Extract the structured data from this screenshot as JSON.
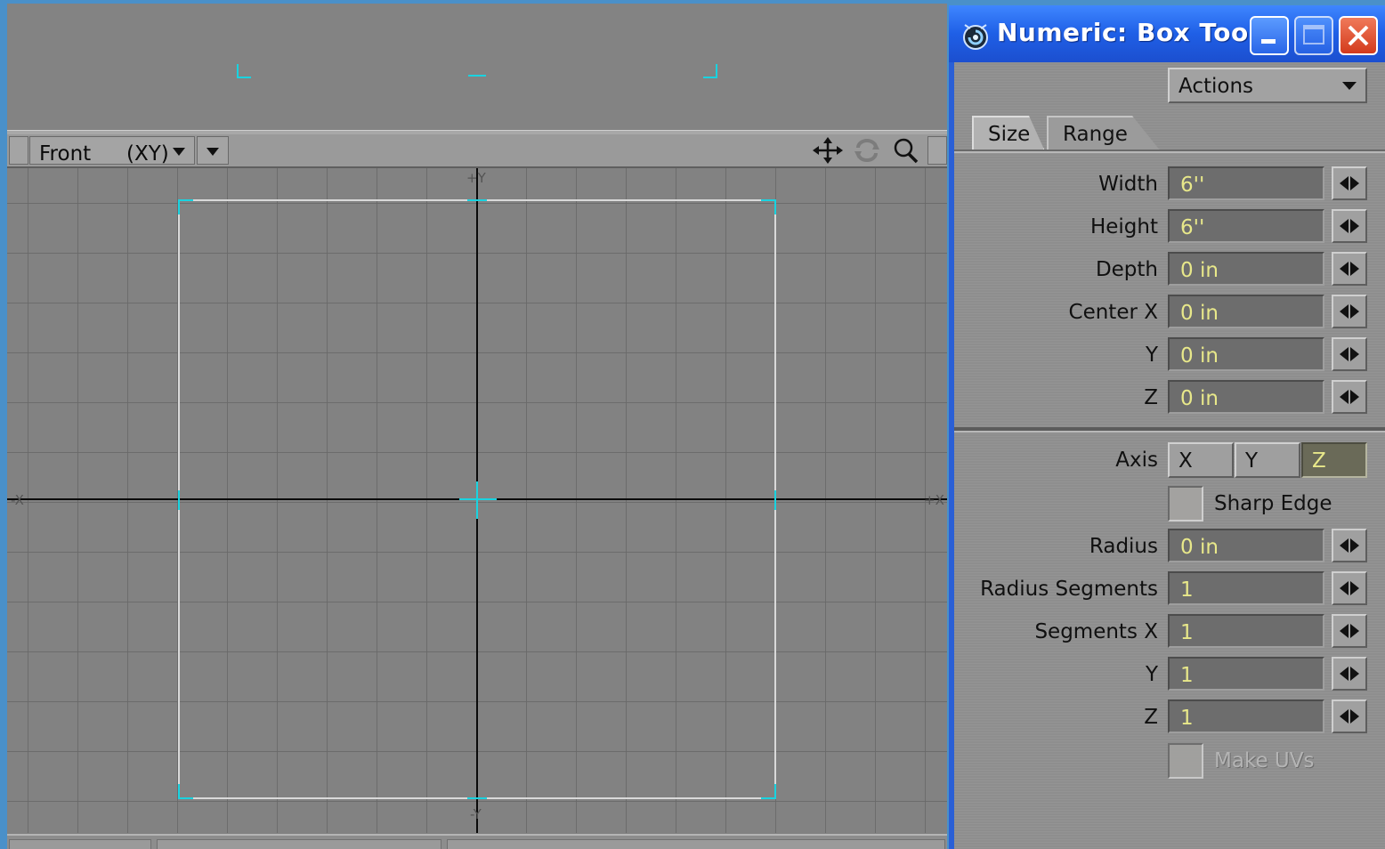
{
  "viewport": {
    "view_name": "Front",
    "view_axes": "(XY)",
    "axis_labels": {
      "top": "+Y",
      "bottom": "-Y",
      "left": "-X",
      "right": "+X"
    }
  },
  "panel": {
    "title": "Numeric: Box Tool",
    "actions_label": "Actions",
    "tabs": [
      {
        "label": "Size"
      },
      {
        "label": "Range"
      }
    ],
    "fields": {
      "width": {
        "label": "Width",
        "value": "6''"
      },
      "height": {
        "label": "Height",
        "value": "6''"
      },
      "depth": {
        "label": "Depth",
        "value": "0 in"
      },
      "center_x": {
        "label": "Center X",
        "value": "0 in"
      },
      "center_y": {
        "label": "Y",
        "value": "0 in"
      },
      "center_z": {
        "label": "Z",
        "value": "0 in"
      },
      "radius": {
        "label": "Radius",
        "value": "0 in"
      },
      "radius_segments": {
        "label": "Radius Segments",
        "value": "1"
      },
      "segments_x": {
        "label": "Segments X",
        "value": "1"
      },
      "segments_y": {
        "label": "Y",
        "value": "1"
      },
      "segments_z": {
        "label": "Z",
        "value": "1"
      }
    },
    "axis": {
      "label": "Axis",
      "options": [
        "X",
        "Y",
        "Z"
      ],
      "selected": "Z"
    },
    "sharp_edge": {
      "label": "Sharp Edge",
      "checked": false
    },
    "make_uvs": {
      "label": "Make UVs",
      "checked": false,
      "enabled": false
    }
  },
  "colors": {
    "handle": "#19d3e0",
    "title_bar": "#1f5fe6",
    "field_text": "#e8e88a",
    "grid_bg": "#828282"
  }
}
